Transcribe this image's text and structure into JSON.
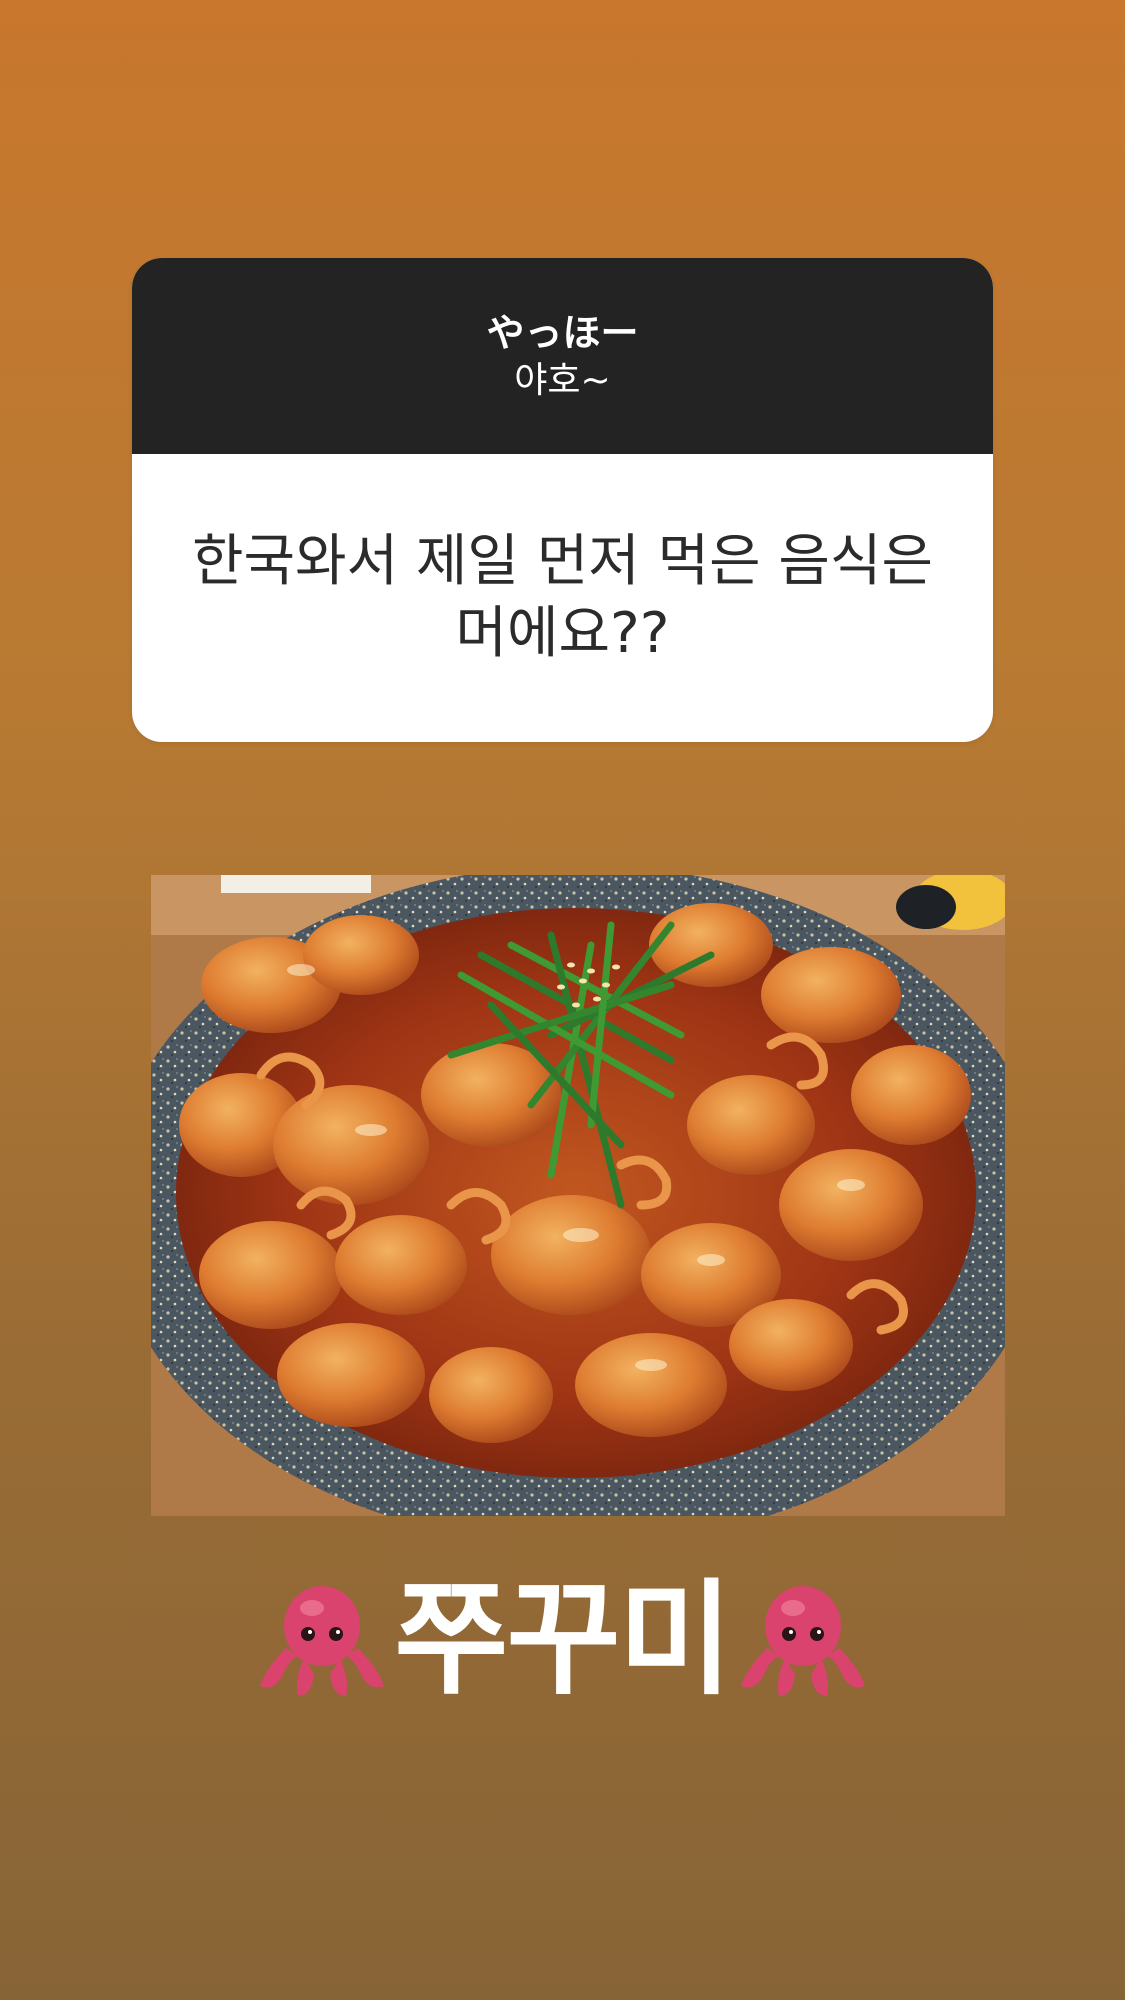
{
  "question_sticker": {
    "title": "やっほー",
    "subtitle": "야호~",
    "question": "한국와서 제일 먼저 먹은 음식은 머에요??"
  },
  "photo": {
    "subject": "spicy stir-fried webfoot octopus in stone pot with chives and sesame"
  },
  "caption": {
    "text": "쭈꾸미",
    "left_icon": "octopus-emoji",
    "right_icon": "octopus-emoji"
  },
  "colors": {
    "background_top": "#c8772d",
    "background_bottom": "#876436",
    "sticker_header": "#232323",
    "sticker_body": "#ffffff",
    "caption_text": "#ffffff",
    "octopus": "#d9436d"
  }
}
